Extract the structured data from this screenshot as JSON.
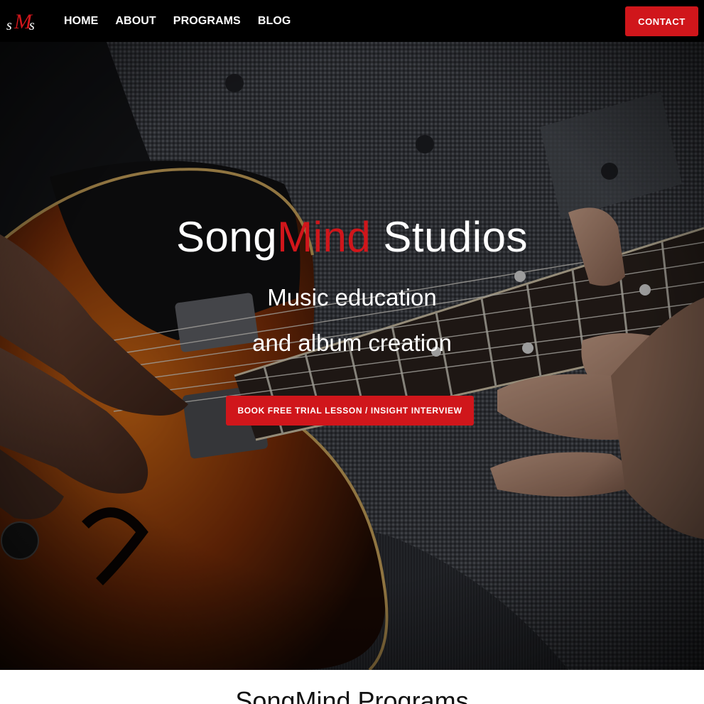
{
  "nav": {
    "logo_text": "sMs",
    "links": [
      "HOME",
      "ABOUT",
      "PROGRAMS",
      "BLOG"
    ],
    "contact_label": "CONTACT"
  },
  "hero": {
    "title_part1": "Song",
    "title_part2": "Mind",
    "title_part3": " Studios",
    "subtitle_line1": "Music education",
    "subtitle_line2": "and album creation",
    "cta_label": "BOOK FREE TRIAL LESSON / INSIGHT INTERVIEW",
    "background_image": "guitar-player-photo"
  },
  "programs": {
    "heading": "SongMind Programs"
  },
  "colors": {
    "accent": "#d0161b",
    "nav_bg": "#000000",
    "text_light": "#ffffff"
  }
}
